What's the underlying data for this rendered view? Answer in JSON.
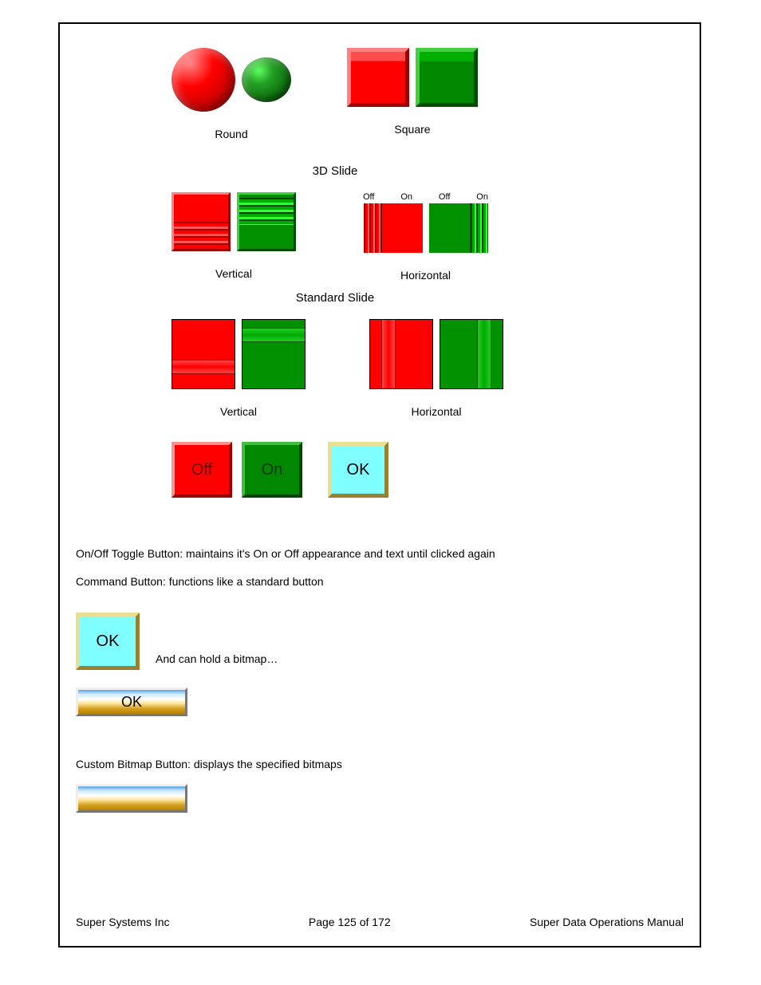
{
  "labels": {
    "round": "Round",
    "square": "Square",
    "slide3d": "3D Slide",
    "vertical": "Vertical",
    "horizontal": "Horizontal",
    "standardSlide": "Standard Slide",
    "off": "Off",
    "on": "On",
    "ok": "OK"
  },
  "scale": {
    "off1": "Off",
    "on1": "On",
    "off2": "Off",
    "on2": "On"
  },
  "text": {
    "toggle": "On/Off Toggle Button: maintains it's On or Off appearance and text until clicked again",
    "command": "Command Button: functions like a standard button",
    "bitmapHold": "And can hold a bitmap…",
    "customBitmap": "Custom Bitmap Button: displays the specified bitmaps"
  },
  "footer": {
    "left": "Super Systems Inc",
    "center": "Page 125 of 172",
    "right": "Super Data Operations Manual"
  }
}
